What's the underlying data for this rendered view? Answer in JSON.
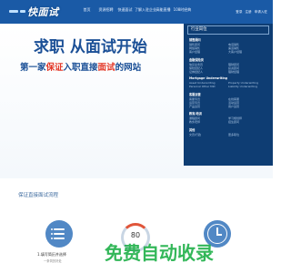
{
  "header": {
    "logo": "快面试",
    "nav": [
      "首页",
      "资源招聘",
      "快速面试",
      "了解入驻企业",
      "高能直播",
      "108时经典"
    ],
    "login": [
      "登录",
      "注册",
      "申请入驻"
    ]
  },
  "hero": {
    "title": "求职 从面试开始",
    "subtitle_prefix": "第一家",
    "subtitle_highlight1": "保证",
    "subtitle_mid": "入职直接",
    "subtitle_highlight2": "面试",
    "subtitle_suffix": "的网站"
  },
  "panel": {
    "head": "行业岗位",
    "sections": [
      {
        "title": "销售顾问",
        "items": [
          "销售顾问",
          "电话销售",
          "网络销售",
          "渠道销售",
          "客户经理",
          "大客户经理"
        ]
      },
      {
        "title": "金融保险类",
        "items": [
          "信贷业务员",
          "理财顾问",
          "保险经纪人",
          "投资顾问",
          "证券经纪人",
          "理财经理"
        ]
      },
      {
        "title": "Mortgage Underwriting",
        "items": [
          "Asset Underwriting",
          "Property Underwriting",
          "Personal Other Mkt",
          "Liability Underwriting"
        ]
      },
      {
        "title": "客服运营",
        "items": [
          "客服专员",
          "在线客服",
          "运营专员",
          "活动运营",
          "产品运营",
          "用户运营"
        ]
      },
      {
        "title": "教育/培训",
        "items": [
          "课程顾问",
          "学习规划师",
          "教务老师",
          "招生顾问"
        ]
      },
      {
        "title": "其他",
        "items": [
          "文员/行政",
          "更多职位"
        ]
      }
    ]
  },
  "process": {
    "title": "保证直接面试流程",
    "gauge_value": "80",
    "step1_label": "1.填写简历并选择",
    "step1_note": "一条简历好处"
  },
  "watermark": "免费自动收录"
}
